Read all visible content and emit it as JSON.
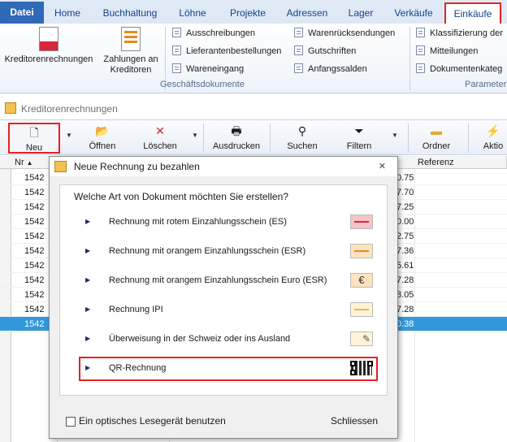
{
  "ribbon": {
    "file_tab": "Datei",
    "tabs": [
      "Home",
      "Buchhaltung",
      "Löhne",
      "Projekte",
      "Adressen",
      "Lager",
      "Verkäufe",
      "Einkäufe"
    ],
    "big_buttons": [
      {
        "label": "Kreditorenrechnungen",
        "icon": "invoice-red-icon"
      },
      {
        "label": "Zahlungen an Kreditoren",
        "icon": "payment-document-icon"
      }
    ],
    "col1": [
      "Ausschreibungen",
      "Lieferantenbestellungen",
      "Wareneingang"
    ],
    "col2": [
      "Warenrücksendungen",
      "Gutschriften",
      "Anfangssalden"
    ],
    "col3": [
      "Klassifizierung der",
      "Mitteilungen",
      "Dokumentenkateg"
    ],
    "group_label": "Geschäftsdokumente",
    "group_label_right": "Parameter"
  },
  "pane": {
    "title": "Kreditorenrechnungen"
  },
  "toolbar": {
    "new": "Neu",
    "open": "Öffnen",
    "delete": "Löschen",
    "print": "Ausdrucken",
    "search": "Suchen",
    "filter": "Filtern",
    "folder": "Ordner",
    "actions": "Aktio"
  },
  "grid": {
    "col_nr": "Nr",
    "col_ref": "Referenz",
    "rows": [
      {
        "nr": "1542",
        "val": "0.75"
      },
      {
        "nr": "1542",
        "val": "7.70"
      },
      {
        "nr": "1542",
        "val": "7.25"
      },
      {
        "nr": "1542",
        "val": "0.00"
      },
      {
        "nr": "1542",
        "val": "2.75"
      },
      {
        "nr": "1542",
        "val": "7.36"
      },
      {
        "nr": "1542",
        "val": "5.61"
      },
      {
        "nr": "1542",
        "val": "7.28"
      },
      {
        "nr": "1542",
        "val": "8.05"
      },
      {
        "nr": "1542",
        "val": "7.28"
      },
      {
        "nr": "1542",
        "val": "0.38"
      }
    ]
  },
  "dialog": {
    "title": "Neue Rechnung zu bezahlen",
    "close": "✕",
    "question": "Welche Art von Dokument möchten Sie erstellen?",
    "options": [
      {
        "label": "Rechnung mit rotem Einzahlungsschein (ES)",
        "icon": "red-slip-icon"
      },
      {
        "label": "Rechnung mit orangem Einzahlungsschein (ESR)",
        "icon": "orange-slip-icon"
      },
      {
        "label": "Rechnung mit orangem Einzahlungsschein Euro (ESR)",
        "icon": "euro-slip-icon"
      },
      {
        "label": "Rechnung IPI",
        "icon": "ipi-slip-icon"
      },
      {
        "label": "Überweisung in der Schweiz oder ins Ausland",
        "icon": "transfer-slip-icon"
      },
      {
        "label": "QR-Rechnung",
        "icon": "qr-code-icon"
      }
    ],
    "checkbox": "Ein optisches Lesegerät benutzen",
    "close_button": "Schliessen"
  },
  "colors": {
    "accent": "#2f6ab6",
    "highlight": "#e52121",
    "selection": "#3398db"
  }
}
